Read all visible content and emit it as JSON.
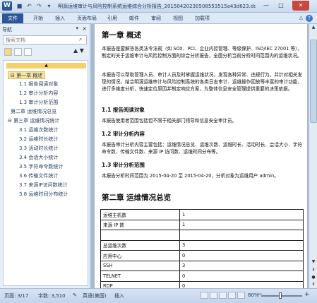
{
  "window": {
    "title": "明源运维审计与风险控制系统运维综合分析报告_20150420230508553515a43d623.doc [兼...",
    "app_logo": "W",
    "qat_icons": [
      "save-icon",
      "undo-icon",
      "redo-icon",
      "customize-icon"
    ],
    "qat_glyphs": [
      "■",
      "↶",
      "↷",
      "▾"
    ],
    "controls": {
      "minimize": "—",
      "maximize": "□",
      "close": "✕"
    }
  },
  "ribbon": {
    "file_tab": "文件",
    "tabs": [
      "开始",
      "插入",
      "页面布局",
      "引用",
      "邮件",
      "审阅",
      "视图",
      "加载项"
    ],
    "minimize_glyph": "△",
    "help_glyph": "?"
  },
  "nav_pane": {
    "title": "导航",
    "menu_glyph": "▾",
    "close_glyph": "×",
    "search_placeholder": "搜索文档",
    "search_glyph": "⌕",
    "arrows": "▲ ▼",
    "up_glyph": "▲",
    "items": [
      {
        "label": "⊟ 第一章 概述",
        "level": 1,
        "selected": true
      },
      {
        "label": "1.1 报告阅读对象",
        "level": 2,
        "selected": false
      },
      {
        "label": "1.2 审计分析内容",
        "level": 2,
        "selected": false
      },
      {
        "label": "1.3 审计分析范围",
        "level": 2,
        "selected": false
      },
      {
        "label": "第二章 运维情况总览",
        "level": 1,
        "selected": false
      },
      {
        "label": "⊟ 第三章 运维情况统计",
        "level": 1,
        "selected": false
      },
      {
        "label": "3.1 运维次数统计",
        "level": 2,
        "selected": false
      },
      {
        "label": "3.2 运维时长统计",
        "level": 2,
        "selected": false
      },
      {
        "label": "3.3 活动时长统计",
        "level": 2,
        "selected": false
      },
      {
        "label": "3.4 会话大小统计",
        "level": 2,
        "selected": false
      },
      {
        "label": "3.5 字符命令数统计",
        "level": 2,
        "selected": false
      },
      {
        "label": "3.6 传输文件统计",
        "level": 2,
        "selected": false
      },
      {
        "label": "3.7 来源IP访问数统计",
        "level": 2,
        "selected": false
      },
      {
        "label": "3.8 运维时间分布统计",
        "level": 2,
        "selected": false
      }
    ]
  },
  "document": {
    "chapter1_title": "第一章 概述",
    "para1": "本报告是要解答各类法令法规（如 SOX、PCI、企业内控管理、等级保护、ISO/IEC 27001 等），制定的关于运维审计与风险控制方面的综合分析报告，全面分析当前分析时间范围内的运维状况。",
    "para2": "本报告可以帮助管理人员、审计人员及时掌握运维状况，发现各种异常、违规行为，并针对相关发现的情况，结合明源运维审计与风险控制系统的各类日志审计、运维操作回放等丰富的审计功能，进行多维度分析，快速定位原因并制定响应方案，为整体信息安全管理提供重要的决策依据。",
    "section1_1": "1.1 报告阅读对象",
    "para3": "本报告使用者范围包括但不限于相关部门领导和信息安全审计员。",
    "section1_2": "1.2 审计分析内容",
    "para4": "本报告审计分析内容主要包括：运维情况总览、运维次数、运维时长、活动时长、会话大小、字符命令数、传输文件数、来源 IP 访问数、运维时间分布等。",
    "section1_3": "1.3 审计分析范围",
    "para5": "本报告分析时间范围为 2015-04-20 至 2015-04-20，分析对象为运维用户 admin。",
    "chapter2_title": "第二章 运维情况总览",
    "table_rows": [
      [
        "运维主机数",
        "1"
      ],
      [
        "来源 IP 数",
        "1"
      ],
      [
        "",
        ""
      ],
      [
        "总运维次数",
        "3"
      ],
      [
        "应用中心",
        "0"
      ],
      [
        "SSH",
        "3"
      ],
      [
        "TELNET",
        "0"
      ],
      [
        "RDP",
        "0"
      ]
    ]
  },
  "statusbar": {
    "page": "页面: 3/17",
    "words": "字数: 3,510",
    "language": "英语(美国)",
    "mode": "插入",
    "zoom": "80%",
    "zoom_minus": "−",
    "zoom_plus": "+"
  },
  "scrollbar": {
    "up_glyph": "▲",
    "down_glyph": "▼"
  }
}
